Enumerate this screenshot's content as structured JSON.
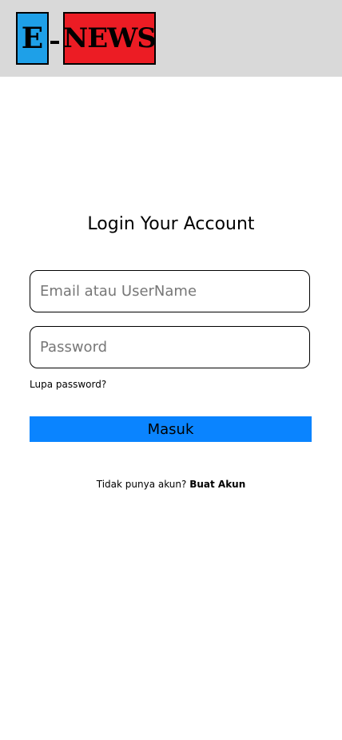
{
  "header": {
    "logo": {
      "letter": "E",
      "separator": "-",
      "word": "NEWS",
      "colors": {
        "letter_bg": "#1ea0e8",
        "word_bg": "#ec1c24",
        "outline": "#000000"
      }
    },
    "background": "#d9d9d9"
  },
  "login": {
    "title": "Login Your Account",
    "email_placeholder": "Email atau UserName",
    "email_value": "",
    "password_placeholder": "Password",
    "password_value": "",
    "forgot_label": "Lupa password?",
    "submit_label": "Masuk",
    "submit_color": "#0a84ff",
    "register_prompt": "Tidak punya akun?",
    "register_link": "Buat Akun"
  }
}
